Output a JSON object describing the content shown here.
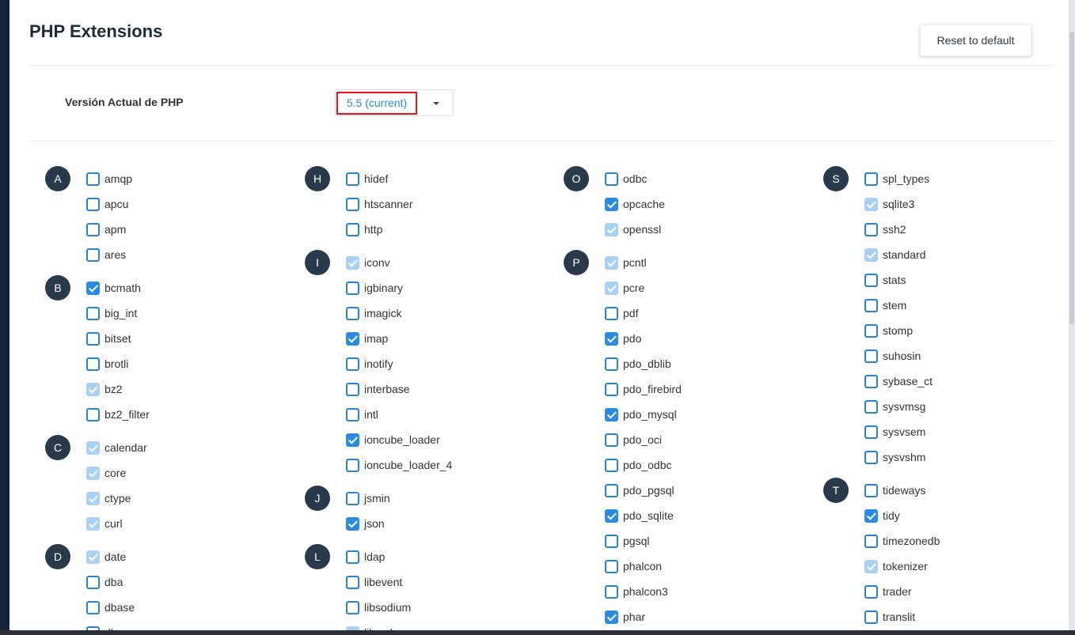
{
  "page": {
    "title": "PHP Extensions",
    "reset_label": "Reset to default",
    "version_label": "Versión Actual de PHP",
    "version_value": "5.5 (current)"
  },
  "colors": {
    "accent": "#2c8ae0",
    "disabled_check": "#a9d1f3",
    "letter_badge": "#293a4d",
    "highlight_border": "#e0161c"
  },
  "columns": [
    {
      "groups": [
        {
          "letter": "A",
          "items": [
            {
              "name": "amqp",
              "state": "unchecked"
            },
            {
              "name": "apcu",
              "state": "unchecked"
            },
            {
              "name": "apm",
              "state": "unchecked"
            },
            {
              "name": "ares",
              "state": "unchecked"
            }
          ]
        },
        {
          "letter": "B",
          "items": [
            {
              "name": "bcmath",
              "state": "checked"
            },
            {
              "name": "big_int",
              "state": "unchecked"
            },
            {
              "name": "bitset",
              "state": "unchecked"
            },
            {
              "name": "brotli",
              "state": "unchecked"
            },
            {
              "name": "bz2",
              "state": "disabled"
            },
            {
              "name": "bz2_filter",
              "state": "unchecked"
            }
          ]
        },
        {
          "letter": "C",
          "items": [
            {
              "name": "calendar",
              "state": "disabled"
            },
            {
              "name": "core",
              "state": "disabled"
            },
            {
              "name": "ctype",
              "state": "disabled"
            },
            {
              "name": "curl",
              "state": "disabled"
            }
          ]
        },
        {
          "letter": "D",
          "items": [
            {
              "name": "date",
              "state": "disabled"
            },
            {
              "name": "dba",
              "state": "unchecked"
            },
            {
              "name": "dbase",
              "state": "unchecked"
            },
            {
              "name": "dbx",
              "state": "unchecked"
            }
          ]
        }
      ]
    },
    {
      "groups": [
        {
          "letter": "H",
          "items": [
            {
              "name": "hidef",
              "state": "unchecked"
            },
            {
              "name": "htscanner",
              "state": "unchecked"
            },
            {
              "name": "http",
              "state": "unchecked"
            }
          ]
        },
        {
          "letter": "I",
          "items": [
            {
              "name": "iconv",
              "state": "disabled"
            },
            {
              "name": "igbinary",
              "state": "unchecked"
            },
            {
              "name": "imagick",
              "state": "unchecked"
            },
            {
              "name": "imap",
              "state": "checked"
            },
            {
              "name": "inotify",
              "state": "unchecked"
            },
            {
              "name": "interbase",
              "state": "unchecked"
            },
            {
              "name": "intl",
              "state": "unchecked"
            },
            {
              "name": "ioncube_loader",
              "state": "checked"
            },
            {
              "name": "ioncube_loader_4",
              "state": "unchecked"
            }
          ]
        },
        {
          "letter": "J",
          "items": [
            {
              "name": "jsmin",
              "state": "unchecked"
            },
            {
              "name": "json",
              "state": "checked"
            }
          ]
        },
        {
          "letter": "L",
          "items": [
            {
              "name": "ldap",
              "state": "unchecked"
            },
            {
              "name": "libevent",
              "state": "unchecked"
            },
            {
              "name": "libsodium",
              "state": "unchecked"
            },
            {
              "name": "libxml",
              "state": "disabled"
            }
          ]
        }
      ]
    },
    {
      "groups": [
        {
          "letter": "O",
          "items": [
            {
              "name": "odbc",
              "state": "unchecked"
            },
            {
              "name": "opcache",
              "state": "checked"
            },
            {
              "name": "openssl",
              "state": "disabled"
            }
          ]
        },
        {
          "letter": "P",
          "items": [
            {
              "name": "pcntl",
              "state": "disabled"
            },
            {
              "name": "pcre",
              "state": "disabled"
            },
            {
              "name": "pdf",
              "state": "unchecked"
            },
            {
              "name": "pdo",
              "state": "checked"
            },
            {
              "name": "pdo_dblib",
              "state": "unchecked"
            },
            {
              "name": "pdo_firebird",
              "state": "unchecked"
            },
            {
              "name": "pdo_mysql",
              "state": "checked"
            },
            {
              "name": "pdo_oci",
              "state": "unchecked"
            },
            {
              "name": "pdo_odbc",
              "state": "unchecked"
            },
            {
              "name": "pdo_pgsql",
              "state": "unchecked"
            },
            {
              "name": "pdo_sqlite",
              "state": "checked"
            },
            {
              "name": "pgsql",
              "state": "unchecked"
            },
            {
              "name": "phalcon",
              "state": "unchecked"
            },
            {
              "name": "phalcon3",
              "state": "unchecked"
            },
            {
              "name": "phar",
              "state": "checked"
            }
          ]
        }
      ]
    },
    {
      "groups": [
        {
          "letter": "S",
          "items": [
            {
              "name": "spl_types",
              "state": "unchecked"
            },
            {
              "name": "sqlite3",
              "state": "disabled"
            },
            {
              "name": "ssh2",
              "state": "unchecked"
            },
            {
              "name": "standard",
              "state": "disabled"
            },
            {
              "name": "stats",
              "state": "unchecked"
            },
            {
              "name": "stem",
              "state": "unchecked"
            },
            {
              "name": "stomp",
              "state": "unchecked"
            },
            {
              "name": "suhosin",
              "state": "unchecked"
            },
            {
              "name": "sybase_ct",
              "state": "unchecked"
            },
            {
              "name": "sysvmsg",
              "state": "unchecked"
            },
            {
              "name": "sysvsem",
              "state": "unchecked"
            },
            {
              "name": "sysvshm",
              "state": "unchecked"
            }
          ]
        },
        {
          "letter": "T",
          "items": [
            {
              "name": "tideways",
              "state": "unchecked"
            },
            {
              "name": "tidy",
              "state": "checked"
            },
            {
              "name": "timezonedb",
              "state": "unchecked"
            },
            {
              "name": "tokenizer",
              "state": "disabled"
            },
            {
              "name": "trader",
              "state": "unchecked"
            },
            {
              "name": "translit",
              "state": "unchecked"
            }
          ]
        }
      ]
    }
  ]
}
